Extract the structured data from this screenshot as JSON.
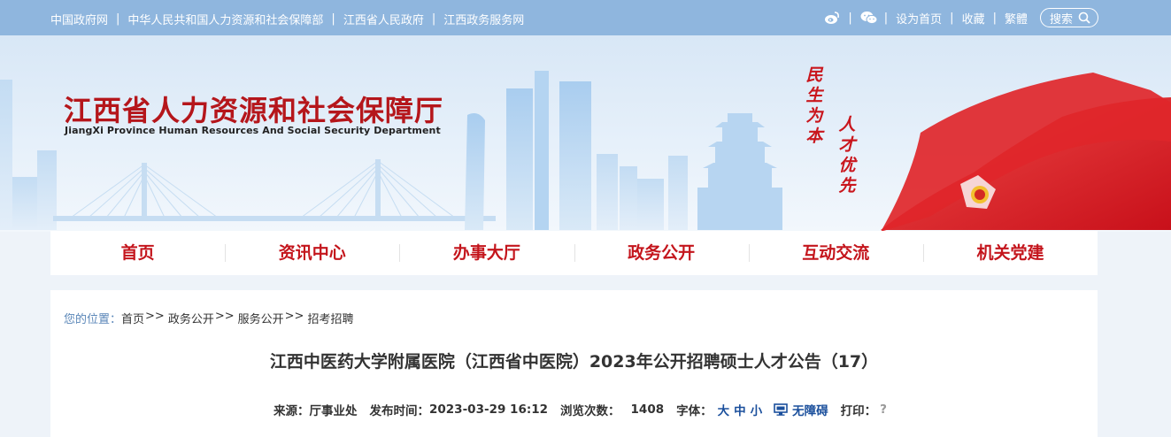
{
  "topbar": {
    "links": [
      "中国政府网",
      "中华人民共和国人力资源和社会保障部",
      "江西省人民政府",
      "江西政务服务网"
    ],
    "right_links": [
      "设为首页",
      "收藏",
      "繁體"
    ],
    "search_label": "搜索",
    "icons": [
      "weibo-icon",
      "wechat-icon",
      "search-icon"
    ]
  },
  "header": {
    "title": "江西省人力资源和社会保障厅",
    "subtitle": "JiangXi Province Human Resources And Social Security Department",
    "slogan_1": [
      "民",
      "生",
      "为",
      "本"
    ],
    "slogan_2": [
      "人",
      "才",
      "优",
      "先"
    ]
  },
  "nav": {
    "items": [
      "首页",
      "资讯中心",
      "办事大厅",
      "政务公开",
      "互动交流",
      "机关党建"
    ]
  },
  "breadcrumb": {
    "prefix": "您的位置：",
    "items": [
      "首页",
      "政务公开",
      "服务公开",
      "招考招聘"
    ],
    "separator": ">>"
  },
  "article": {
    "title": "江西中医药大学附属医院（江西省中医院）2023年公开招聘硕士人才公告（17）",
    "source_label": "来源：",
    "source": "厅事业处",
    "time_label": "发布时间：",
    "time": "2023-03-29 16:12",
    "views_label": "浏览次数：",
    "views": "1408",
    "font_label": "字体：",
    "font_sizes": [
      "大",
      "中",
      "小"
    ],
    "accessibility": "无障碍",
    "print_label": "打印：",
    "print_icon": "?"
  },
  "colors": {
    "brand_red": "#c4151c",
    "topbar_blue": "#8fb6de",
    "link_blue": "#1a4f9c"
  }
}
